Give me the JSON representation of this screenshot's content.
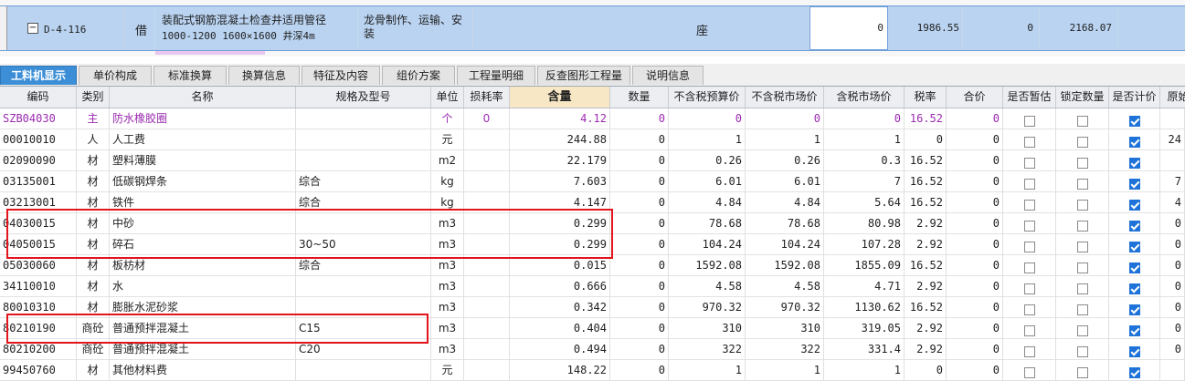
{
  "top_row": {
    "expand": "−",
    "code": "D-4-116",
    "type": "借",
    "name_line1": "装配式钢筋混凝土检查井适用管径",
    "name_line2": "1000-1200 1600×1600 井深4m",
    "spec": "龙骨制作、运输、安装",
    "unit": "座",
    "qty": "0",
    "v1": "1986.55",
    "v2": "0",
    "v3": "2168.07"
  },
  "tabs": [
    "工料机显示",
    "单价构成",
    "标准换算",
    "换算信息",
    "特征及内容",
    "组价方案",
    "工程量明细",
    "反查图形工程量",
    "说明信息"
  ],
  "headers": [
    "编码",
    "类别",
    "名称",
    "规格及型号",
    "单位",
    "损耗率",
    "含量",
    "数量",
    "不含税预算价",
    "不含税市场价",
    "含税市场价",
    "税率",
    "合价",
    "是否暂估",
    "锁定数量",
    "是否计价",
    "原始"
  ],
  "rows": [
    {
      "code": "SZB04030",
      "type": "主",
      "name": "防水橡胶圈",
      "spec": "",
      "unit": "个",
      "loss": "0",
      "content": "4.12",
      "qty": "0",
      "p1": "0",
      "p2": "0",
      "p3": "0",
      "tax": "16.52",
      "total": "0",
      "est": false,
      "lock": false,
      "priced": true,
      "orig": "",
      "purple": true
    },
    {
      "code": "00010010",
      "type": "人",
      "name": "人工费",
      "spec": "",
      "unit": "元",
      "loss": "",
      "content": "244.88",
      "qty": "0",
      "p1": "1",
      "p2": "1",
      "p3": "1",
      "tax": "0",
      "total": "0",
      "est": false,
      "lock": false,
      "priced": true,
      "orig": "24",
      "purple": false
    },
    {
      "code": "02090090",
      "type": "材",
      "name": "塑料薄膜",
      "spec": "",
      "unit": "m2",
      "loss": "",
      "content": "22.179",
      "qty": "0",
      "p1": "0.26",
      "p2": "0.26",
      "p3": "0.3",
      "tax": "16.52",
      "total": "0",
      "est": false,
      "lock": false,
      "priced": true,
      "orig": "",
      "purple": false
    },
    {
      "code": "03135001",
      "type": "材",
      "name": "低碳钢焊条",
      "spec": "综合",
      "unit": "kg",
      "loss": "",
      "content": "7.603",
      "qty": "0",
      "p1": "6.01",
      "p2": "6.01",
      "p3": "7",
      "tax": "16.52",
      "total": "0",
      "est": false,
      "lock": false,
      "priced": true,
      "orig": "7",
      "purple": false
    },
    {
      "code": "03213001",
      "type": "材",
      "name": "铁件",
      "spec": "综合",
      "unit": "kg",
      "loss": "",
      "content": "4.147",
      "qty": "0",
      "p1": "4.84",
      "p2": "4.84",
      "p3": "5.64",
      "tax": "16.52",
      "total": "0",
      "est": false,
      "lock": false,
      "priced": true,
      "orig": "4",
      "purple": false
    },
    {
      "code": "04030015",
      "type": "材",
      "name": "中砂",
      "spec": "",
      "unit": "m3",
      "loss": "",
      "content": "0.299",
      "qty": "0",
      "p1": "78.68",
      "p2": "78.68",
      "p3": "80.98",
      "tax": "2.92",
      "total": "0",
      "est": false,
      "lock": false,
      "priced": true,
      "orig": "0",
      "purple": false
    },
    {
      "code": "04050015",
      "type": "材",
      "name": "碎石",
      "spec": "30~50",
      "unit": "m3",
      "loss": "",
      "content": "0.299",
      "qty": "0",
      "p1": "104.24",
      "p2": "104.24",
      "p3": "107.28",
      "tax": "2.92",
      "total": "0",
      "est": false,
      "lock": false,
      "priced": true,
      "orig": "0",
      "purple": false
    },
    {
      "code": "05030060",
      "type": "材",
      "name": "板枋材",
      "spec": "综合",
      "unit": "m3",
      "loss": "",
      "content": "0.015",
      "qty": "0",
      "p1": "1592.08",
      "p2": "1592.08",
      "p3": "1855.09",
      "tax": "16.52",
      "total": "0",
      "est": false,
      "lock": false,
      "priced": true,
      "orig": "0",
      "purple": false
    },
    {
      "code": "34110010",
      "type": "材",
      "name": "水",
      "spec": "",
      "unit": "m3",
      "loss": "",
      "content": "0.666",
      "qty": "0",
      "p1": "4.58",
      "p2": "4.58",
      "p3": "4.71",
      "tax": "2.92",
      "total": "0",
      "est": false,
      "lock": false,
      "priced": true,
      "orig": "0",
      "purple": false
    },
    {
      "code": "80010310",
      "type": "材",
      "name": "膨胀水泥砂浆",
      "spec": "",
      "unit": "m3",
      "loss": "",
      "content": "0.342",
      "qty": "0",
      "p1": "970.32",
      "p2": "970.32",
      "p3": "1130.62",
      "tax": "16.52",
      "total": "0",
      "est": false,
      "lock": false,
      "priced": true,
      "orig": "0",
      "purple": false
    },
    {
      "code": "80210190",
      "type": "商砼",
      "name": "普通预拌混凝土",
      "spec": "C15",
      "unit": "m3",
      "loss": "",
      "content": "0.404",
      "qty": "0",
      "p1": "310",
      "p2": "310",
      "p3": "319.05",
      "tax": "2.92",
      "total": "0",
      "est": false,
      "lock": false,
      "priced": true,
      "orig": "0",
      "purple": false
    },
    {
      "code": "80210200",
      "type": "商砼",
      "name": "普通预拌混凝土",
      "spec": "C20",
      "unit": "m3",
      "loss": "",
      "content": "0.494",
      "qty": "0",
      "p1": "322",
      "p2": "322",
      "p3": "331.4",
      "tax": "2.92",
      "total": "0",
      "est": false,
      "lock": false,
      "priced": true,
      "orig": "0",
      "purple": false
    },
    {
      "code": "99450760",
      "type": "材",
      "name": "其他材料费",
      "spec": "",
      "unit": "元",
      "loss": "",
      "content": "148.22",
      "qty": "0",
      "p1": "1",
      "p2": "1",
      "p3": "1",
      "tax": "0",
      "total": "0",
      "est": false,
      "lock": false,
      "priced": true,
      "orig": "",
      "purple": false
    }
  ],
  "colors": {
    "tab_active": "#3c8fd6",
    "selected_row": "#b9d3f1",
    "highlight_header": "#f8e7c5",
    "red_box": "#e3141b",
    "purple_text": "#9b2bb0"
  }
}
